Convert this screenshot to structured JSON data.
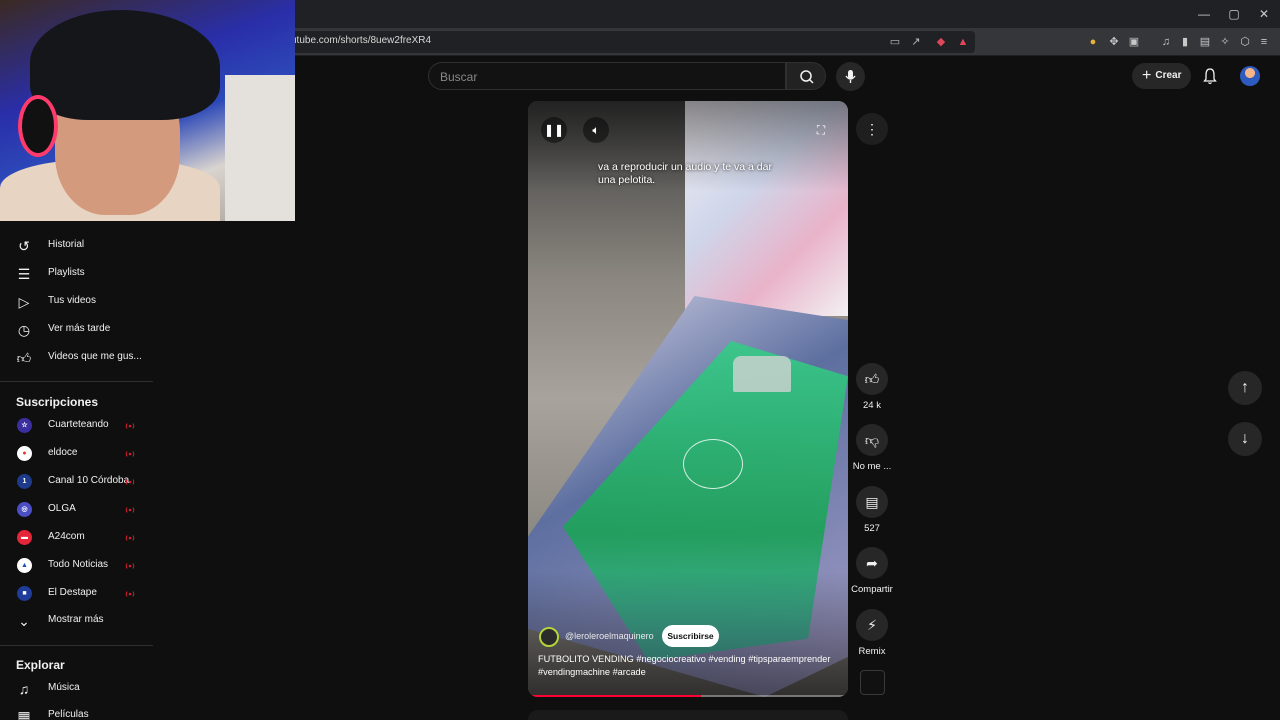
{
  "browser": {
    "url": "utube.com/shorts/8uew2freXR4",
    "window_controls": [
      "—",
      "▢",
      "✕"
    ]
  },
  "topbar": {
    "search_placeholder": "Buscar",
    "create_label": "Crear"
  },
  "sidebar": {
    "you_items": [
      {
        "label": "Historial",
        "icon": "history-icon"
      },
      {
        "label": "Playlists",
        "icon": "playlists-icon"
      },
      {
        "label": "Tus videos",
        "icon": "your-videos-icon"
      },
      {
        "label": "Ver más tarde",
        "icon": "watch-later-icon"
      },
      {
        "label": "Videos que me gus...",
        "icon": "liked-videos-icon"
      }
    ],
    "subscriptions_heading": "Suscripciones",
    "subscriptions": [
      {
        "label": "Cuarteteando",
        "live": true,
        "color": "#3b2fa0"
      },
      {
        "label": "eldoce",
        "live": true,
        "color": "#e53935"
      },
      {
        "label": "Canal 10 Córdoba",
        "live": true,
        "color": "#1e3a8a"
      },
      {
        "label": "OLGA",
        "live": true,
        "color": "#4a4fc4"
      },
      {
        "label": "A24com",
        "live": true,
        "color": "#e5263a"
      },
      {
        "label": "Todo Noticias",
        "live": true,
        "color": "#1b4fb8"
      },
      {
        "label": "El Destape",
        "live": true,
        "color": "#1f3c9a"
      }
    ],
    "show_more_label": "Mostrar más",
    "explore_heading": "Explorar",
    "explore": [
      {
        "label": "Música",
        "icon": "music-icon"
      },
      {
        "label": "Películas",
        "icon": "movies-icon"
      }
    ]
  },
  "short": {
    "caption": "va a reproducir un audio y te va a dar una pelotita.",
    "channel": "@leroleroelmaquinero",
    "subscribe_label": "Suscribirse",
    "description": "FUTBOLITO VENDING #negociocreativo #vending #tipsparaemprender #vendingmachine #arcade",
    "progress_percent": 54
  },
  "actions": {
    "like_count": "24 k",
    "dislike_label": "No me ...",
    "comment_count": "527",
    "share_label": "Compartir",
    "remix_label": "Remix"
  },
  "colors": {
    "background": "#0f0f0f",
    "accent_red": "#ff0033",
    "live_red": "#cc1f2f"
  }
}
